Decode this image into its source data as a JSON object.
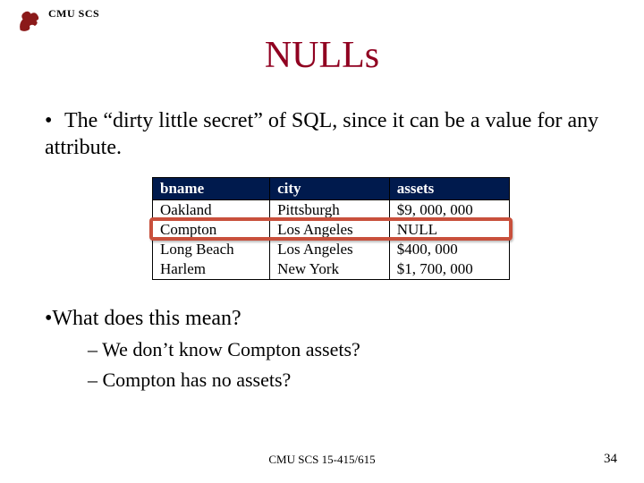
{
  "header": {
    "org": "CMU SCS"
  },
  "title": "NULLs",
  "bullet_main": "The “dirty little secret” of SQL, since it can be a value for any attribute.",
  "table": {
    "columns": [
      "bname",
      "city",
      "assets"
    ],
    "rows": [
      {
        "bname": "Oakland",
        "city": "Pittsburgh",
        "assets": "$9, 000, 000"
      },
      {
        "bname": "Compton",
        "city": "Los Angeles",
        "assets": "NULL"
      },
      {
        "bname": "Long Beach",
        "city": "Los Angeles",
        "assets": "$400, 000"
      },
      {
        "bname": "Harlem",
        "city": "New York",
        "assets": "$1, 700, 000"
      }
    ]
  },
  "bullet_q": "What does this mean?",
  "sub1": "We don’t know Compton assets?",
  "sub2": "Compton has no assets?",
  "footer": "CMU SCS 15-415/615",
  "page": "34"
}
